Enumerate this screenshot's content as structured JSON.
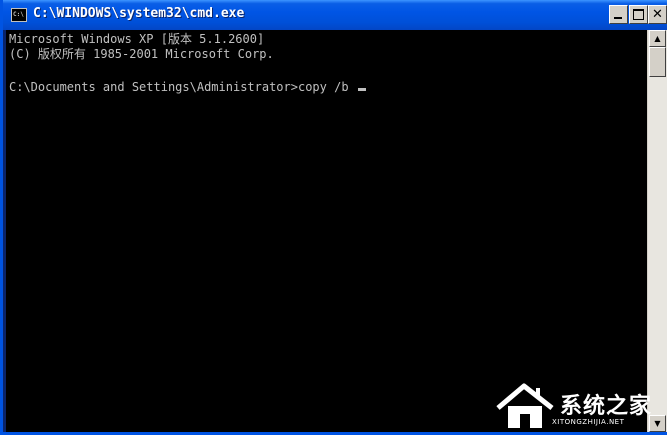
{
  "window": {
    "title": "C:\\WINDOWS\\system32\\cmd.exe",
    "icon_label": "C:\\"
  },
  "console": {
    "lines": [
      "Microsoft Windows XP [版本 5.1.2600]",
      "(C) 版权所有 1985-2001 Microsoft Corp.",
      "C:\\Documents and Settings\\Administrator>copy /b "
    ]
  },
  "controls": {
    "close_glyph": "✕",
    "scroll_up_glyph": "▲",
    "scroll_down_glyph": "▼"
  },
  "watermark": {
    "brand": "系统之家",
    "url": "XITONGZHIJIA.NET"
  },
  "colors": {
    "title_bar": "#0055e5",
    "console_bg": "#000000",
    "console_text": "#c0c0c0"
  }
}
